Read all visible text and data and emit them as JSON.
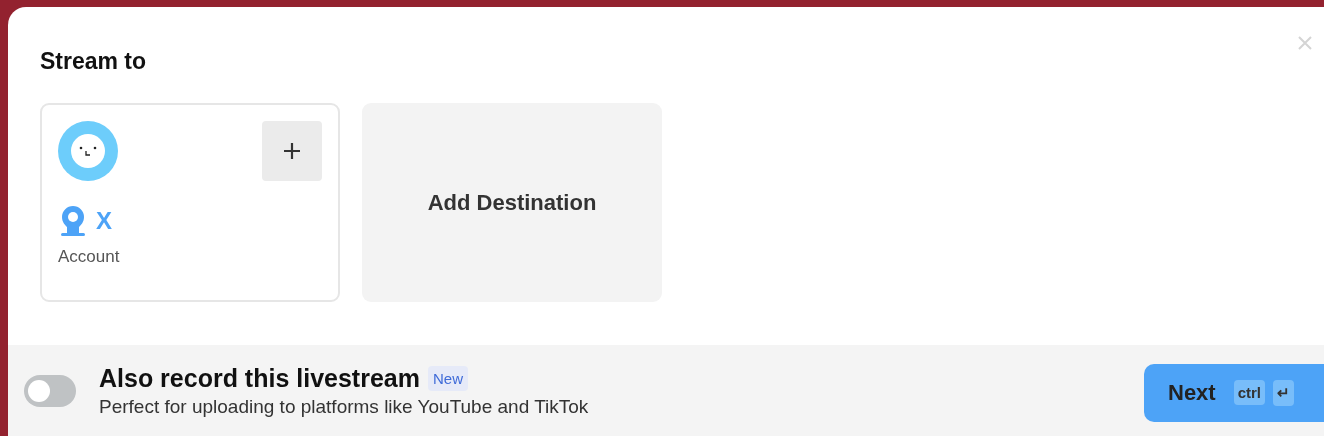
{
  "dialog": {
    "title": "Stream to"
  },
  "destinations": [
    {
      "kind": "account",
      "platform": "X",
      "label": "Account"
    },
    {
      "kind": "add",
      "label": "Add Destination"
    }
  ],
  "footer": {
    "record": {
      "on": false,
      "title": "Also record this livestream",
      "badge": "New",
      "description": "Perfect for uploading to platforms like YouTube and TikTok"
    },
    "next_button": {
      "label": "Next",
      "keys": [
        "ctrl",
        "↵"
      ]
    }
  }
}
